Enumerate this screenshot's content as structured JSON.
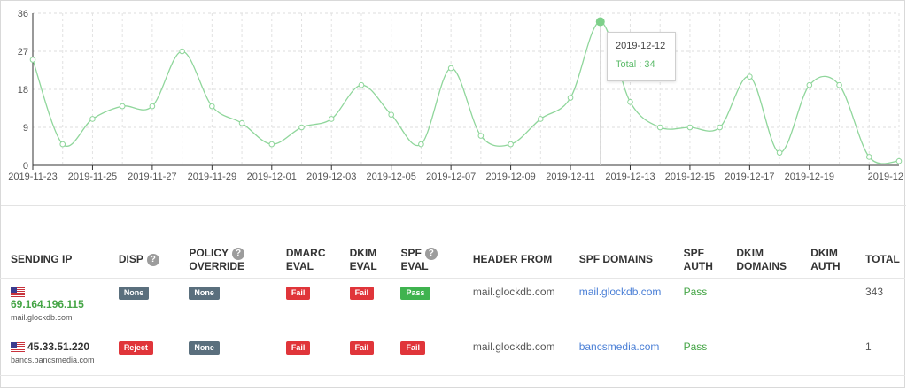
{
  "chart_data": {
    "type": "line",
    "x": [
      "2019-11-23",
      "2019-11-24",
      "2019-11-25",
      "2019-11-26",
      "2019-11-27",
      "2019-11-28",
      "2019-11-29",
      "2019-11-30",
      "2019-12-01",
      "2019-12-02",
      "2019-12-03",
      "2019-12-04",
      "2019-12-05",
      "2019-12-06",
      "2019-12-07",
      "2019-12-08",
      "2019-12-09",
      "2019-12-10",
      "2019-12-11",
      "2019-12-12",
      "2019-12-13",
      "2019-12-14",
      "2019-12-15",
      "2019-12-16",
      "2019-12-17",
      "2019-12-18",
      "2019-12-19",
      "2019-12-20",
      "2019-12-21",
      "2019-12-22"
    ],
    "values": [
      25,
      5,
      11,
      14,
      14,
      27,
      14,
      10,
      5,
      9,
      11,
      19,
      12,
      5,
      23,
      7,
      5,
      11,
      16,
      34,
      15,
      9,
      9,
      9,
      21,
      3,
      19,
      19,
      2,
      1
    ],
    "xtick_labels": [
      "2019-11-23",
      "2019-11-25",
      "2019-11-27",
      "2019-11-29",
      "2019-12-01",
      "2019-12-03",
      "2019-12-05",
      "2019-12-07",
      "2019-12-09",
      "2019-12-11",
      "2019-12-13",
      "2019-12-15",
      "2019-12-17",
      "2019-12-19",
      "2019-12"
    ],
    "ytick_labels": [
      "0",
      "9",
      "18",
      "27",
      "36"
    ],
    "ylim": [
      0,
      36
    ],
    "grid": true,
    "line_color": "#8fd69b",
    "highlight_color": "#7ed08a",
    "tooltip": {
      "date": "2019-12-12",
      "label": "Total : 34"
    }
  },
  "table": {
    "headers": [
      {
        "l1": "SENDING IP",
        "l2": "",
        "help": false
      },
      {
        "l1": "DISP",
        "l2": "",
        "help": true
      },
      {
        "l1": "POLICY",
        "l2": "OVERRIDE",
        "help": true
      },
      {
        "l1": "DMARC",
        "l2": "EVAL",
        "help": false
      },
      {
        "l1": "DKIM",
        "l2": "EVAL",
        "help": false
      },
      {
        "l1": "SPF",
        "l2": "EVAL",
        "help": true
      },
      {
        "l1": "HEADER FROM",
        "l2": "",
        "help": false
      },
      {
        "l1": "SPF DOMAINS",
        "l2": "",
        "help": false
      },
      {
        "l1": "SPF",
        "l2": "AUTH",
        "help": false
      },
      {
        "l1": "DKIM",
        "l2": "DOMAINS",
        "help": false
      },
      {
        "l1": "DKIM",
        "l2": "AUTH",
        "help": false
      },
      {
        "l1": "TOTAL",
        "l2": "",
        "help": false
      }
    ],
    "help_glyph": "?",
    "rows": [
      {
        "ip": "69.164.196.115",
        "host": "mail.glockdb.com",
        "disp": "None",
        "override": "None",
        "dmarc": "Fail",
        "dkim": "Fail",
        "spf": "Pass",
        "header_from": "mail.glockdb.com",
        "spf_domains": "mail.glockdb.com",
        "spf_auth": "Pass",
        "dkim_domains": "",
        "dkim_auth": "",
        "total": "343"
      },
      {
        "ip": "45.33.51.220",
        "host": "bancs.bancsmedia.com",
        "disp": "Reject",
        "override": "None",
        "dmarc": "Fail",
        "dkim": "Fail",
        "spf": "Fail",
        "header_from": "mail.glockdb.com",
        "spf_domains": "bancsmedia.com",
        "spf_auth": "Pass",
        "dkim_domains": "",
        "dkim_auth": "",
        "total": "1"
      }
    ]
  }
}
